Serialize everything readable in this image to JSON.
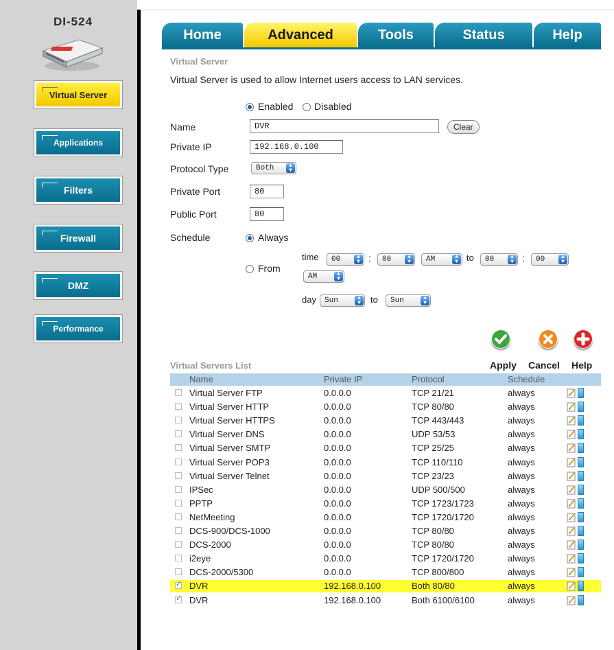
{
  "sidebar": {
    "model": "DI-524",
    "items": [
      {
        "label": "Virtual Server",
        "active": true
      },
      {
        "label": "Applications",
        "active": false
      },
      {
        "label": "Filters",
        "active": false
      },
      {
        "label": "Firewall",
        "active": false
      },
      {
        "label": "DMZ",
        "active": false
      },
      {
        "label": "Performance",
        "active": false
      }
    ]
  },
  "tabs": [
    {
      "label": "Home",
      "active": false
    },
    {
      "label": "Advanced",
      "active": true
    },
    {
      "label": "Tools",
      "active": false
    },
    {
      "label": "Status",
      "active": false
    },
    {
      "label": "Help",
      "active": false
    }
  ],
  "form": {
    "section_title": "Virtual Server",
    "description": "Virtual Server is used to allow Internet users access to LAN services.",
    "enabled_label": "Enabled",
    "disabled_label": "Disabled",
    "enabled": true,
    "name_label": "Name",
    "name_value": "DVR",
    "clear_label": "Clear",
    "private_ip_label": "Private IP",
    "private_ip_value": "192.168.0.100",
    "protocol_label": "Protocol Type",
    "protocol_value": "Both",
    "private_port_label": "Private Port",
    "private_port_value": "80",
    "public_port_label": "Public Port",
    "public_port_value": "80",
    "schedule_label": "Schedule",
    "always_label": "Always",
    "schedule_always": true,
    "from_label": "From",
    "time_label": "time",
    "colon": ":",
    "to_label": "to",
    "day_label": "day",
    "time_from_hour": "00",
    "time_from_min": "00",
    "time_from_ampm": "AM",
    "time_to_hour": "00",
    "time_to_min": "00",
    "time_to_ampm": "AM",
    "day_from": "Sun",
    "day_to": "Sun"
  },
  "actions": {
    "apply_label": "Apply",
    "cancel_label": "Cancel",
    "help_label": "Help",
    "apply_color": "#3ca53c",
    "cancel_color": "#f08a1e",
    "help_color": "#d9262a"
  },
  "list": {
    "title": "Virtual Servers List",
    "headers": [
      "Name",
      "Private IP",
      "Protocol",
      "Schedule"
    ],
    "rows": [
      {
        "checked": false,
        "name": "Virtual Server FTP",
        "ip": "0.0.0.0",
        "protocol": "TCP 21/21",
        "schedule": "always",
        "highlight": false
      },
      {
        "checked": false,
        "name": "Virtual Server HTTP",
        "ip": "0.0.0.0",
        "protocol": "TCP 80/80",
        "schedule": "always",
        "highlight": false
      },
      {
        "checked": false,
        "name": "Virtual Server HTTPS",
        "ip": "0.0.0.0",
        "protocol": "TCP 443/443",
        "schedule": "always",
        "highlight": false
      },
      {
        "checked": false,
        "name": "Virtual Server DNS",
        "ip": "0.0.0.0",
        "protocol": "UDP 53/53",
        "schedule": "always",
        "highlight": false
      },
      {
        "checked": false,
        "name": "Virtual Server SMTP",
        "ip": "0.0.0.0",
        "protocol": "TCP 25/25",
        "schedule": "always",
        "highlight": false
      },
      {
        "checked": false,
        "name": "Virtual Server POP3",
        "ip": "0.0.0.0",
        "protocol": "TCP 110/110",
        "schedule": "always",
        "highlight": false
      },
      {
        "checked": false,
        "name": "Virtual Server Telnet",
        "ip": "0.0.0.0",
        "protocol": "TCP 23/23",
        "schedule": "always",
        "highlight": false
      },
      {
        "checked": false,
        "name": "IPSec",
        "ip": "0.0.0.0",
        "protocol": "UDP 500/500",
        "schedule": "always",
        "highlight": false
      },
      {
        "checked": false,
        "name": "PPTP",
        "ip": "0.0.0.0",
        "protocol": "TCP 1723/1723",
        "schedule": "always",
        "highlight": false
      },
      {
        "checked": false,
        "name": "NetMeeting",
        "ip": "0.0.0.0",
        "protocol": "TCP 1720/1720",
        "schedule": "always",
        "highlight": false
      },
      {
        "checked": false,
        "name": "DCS-900/DCS-1000",
        "ip": "0.0.0.0",
        "protocol": "TCP 80/80",
        "schedule": "always",
        "highlight": false
      },
      {
        "checked": false,
        "name": "DCS-2000",
        "ip": "0.0.0.0",
        "protocol": "TCP 80/80",
        "schedule": "always",
        "highlight": false
      },
      {
        "checked": false,
        "name": "i2eye",
        "ip": "0.0.0.0",
        "protocol": "TCP 1720/1720",
        "schedule": "always",
        "highlight": false
      },
      {
        "checked": false,
        "name": "DCS-2000/5300",
        "ip": "0.0.0.0",
        "protocol": "TCP 800/800",
        "schedule": "always",
        "highlight": false
      },
      {
        "checked": true,
        "name": "DVR",
        "ip": "192.168.0.100",
        "protocol": "Both 80/80",
        "schedule": "always",
        "highlight": true
      },
      {
        "checked": true,
        "name": "DVR",
        "ip": "192.168.0.100",
        "protocol": "Both 6100/6100",
        "schedule": "always",
        "highlight": false
      }
    ]
  },
  "colors": {
    "tab_blue": "#0a6d8d",
    "active_yellow": "#f4c800",
    "list_header": "#b5d3e8",
    "row_highlight": "#ffff33"
  }
}
